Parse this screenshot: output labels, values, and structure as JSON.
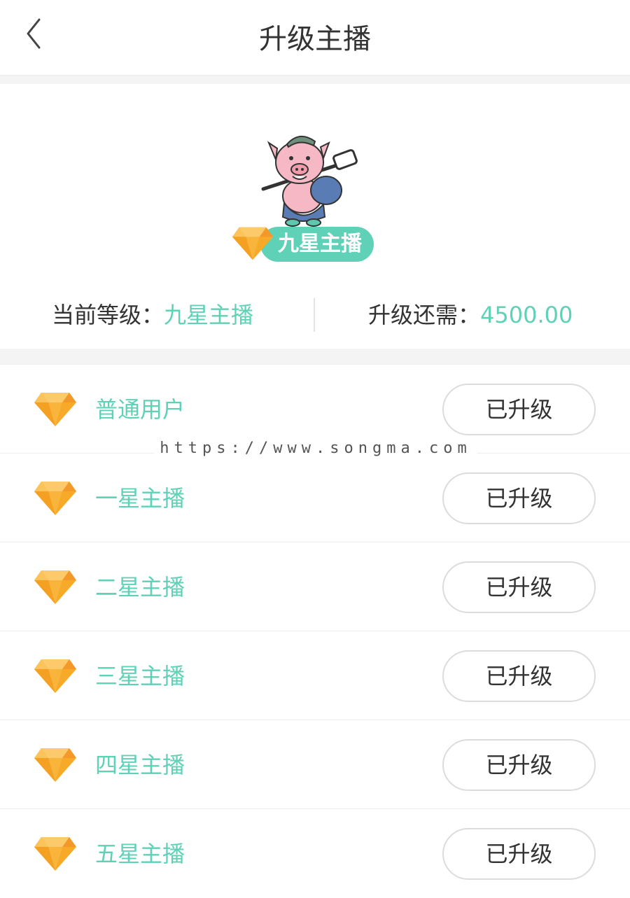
{
  "header": {
    "title": "升级主播",
    "back_icon": "chevron-left-icon"
  },
  "current": {
    "badge_label": "九星主播",
    "badge_icon": "diamond-icon",
    "current_level_label": "当前等级：",
    "current_level_value": "九星主播",
    "needed_label": "升级还需：",
    "needed_value": "4500.00"
  },
  "levels": [
    {
      "name": "普通用户",
      "button": "已升级"
    },
    {
      "name": "一星主播",
      "button": "已升级"
    },
    {
      "name": "二星主播",
      "button": "已升级"
    },
    {
      "name": "三星主播",
      "button": "已升级"
    },
    {
      "name": "四星主播",
      "button": "已升级"
    },
    {
      "name": "五星主播",
      "button": "已升级"
    }
  ],
  "watermark": "https://www.songma.com",
  "colors": {
    "accent": "#5fd1b6",
    "gem": "#f7a928",
    "text": "#333333",
    "divider": "#ededed"
  }
}
